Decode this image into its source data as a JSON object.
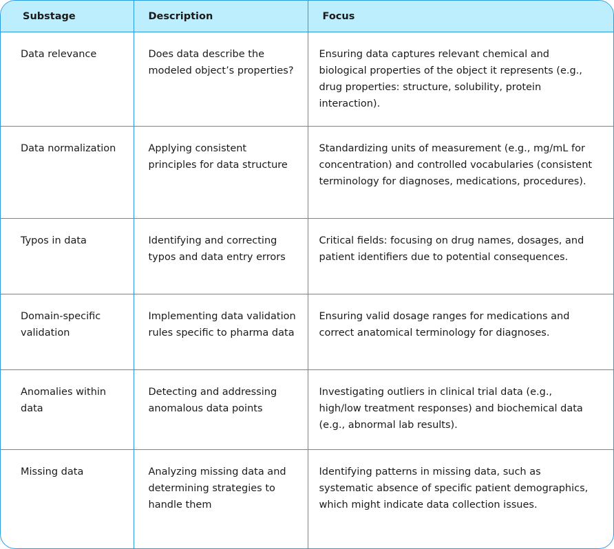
{
  "table": {
    "headers": [
      "Substage",
      "Description",
      "Focus"
    ],
    "rows": [
      {
        "substage": "Data relevance",
        "description": "Does data describe the modeled object’s properties?",
        "focus": "Ensuring data captures relevant chemical and biological properties of the object it represents (e.g., drug properties: structure, solubility, protein interaction)."
      },
      {
        "substage": "Data normalization",
        "description": "Applying consistent principles for data structure",
        "focus": "Standardizing units of measurement (e.g., mg/mL for concentration) and controlled vocabularies (consistent terminology for diagnoses, medications, procedures)."
      },
      {
        "substage": "Typos in data",
        "description": "Identifying and correcting typos and data entry errors",
        "focus": "Critical fields: focusing on drug names, dosages, and patient identifiers due to potential consequences."
      },
      {
        "substage": "Domain-specific validation",
        "description": "Implementing data validation rules specific to pharma data",
        "focus": "Ensuring valid dosage ranges for medications and correct anatomical terminology for diagnoses."
      },
      {
        "substage": "Anomalies within data",
        "description": "Detecting and addressing anomalous data points",
        "focus": "Investigating outliers in clinical trial data (e.g., high/low treatment responses) and biochemical data (e.g., abnormal lab results)."
      },
      {
        "substage": "Missing data",
        "description": "Analyzing missing data and determining strategies to handle them",
        "focus": "Identifying patterns in missing data, such as systematic absence of specific patient demographics, which might indicate data collection issues."
      }
    ]
  },
  "colors": {
    "header_bg": "#bdeefe",
    "border": "#2b9be0",
    "text": "#1a1a1a"
  }
}
